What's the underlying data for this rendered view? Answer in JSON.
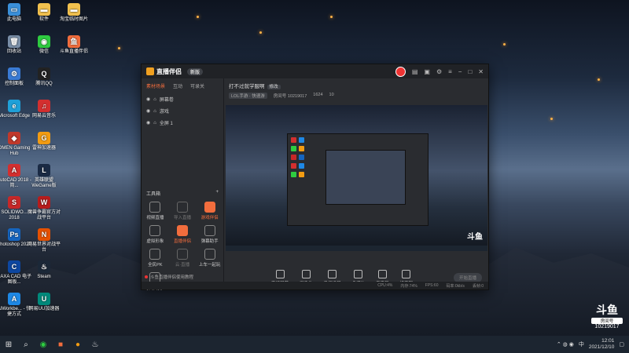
{
  "desktop_icons": [
    {
      "label": "此电脑",
      "col": 0,
      "row": 0,
      "color": "#3a8fd9",
      "glyph": "▭"
    },
    {
      "label": "回收站",
      "col": 0,
      "row": 1,
      "color": "#7a8fa8",
      "glyph": "🗑"
    },
    {
      "label": "控制面板",
      "col": 0,
      "row": 2,
      "color": "#3a7bd5",
      "glyph": "⚙"
    },
    {
      "label": "Microsoft Edge",
      "col": 0,
      "row": 3,
      "color": "#1fa0d8",
      "glyph": "e"
    },
    {
      "label": "OMEN Gaming Hub",
      "col": 0,
      "row": 4,
      "color": "#c0392b",
      "glyph": "◆"
    },
    {
      "label": "AutoCAD 2018 - 简...",
      "col": 0,
      "row": 5,
      "color": "#d32f2f",
      "glyph": "A"
    },
    {
      "label": "SOLIDWO... 2018",
      "col": 0,
      "row": 6,
      "color": "#c62828",
      "glyph": "S"
    },
    {
      "label": "Photoshop 2020",
      "col": 0,
      "row": 7,
      "color": "#1565c0",
      "glyph": "Ps"
    },
    {
      "label": "CAXA CAD 电子图板...",
      "col": 0,
      "row": 8,
      "color": "#0d47a1",
      "glyph": "C"
    },
    {
      "label": "AIWorkbe... - 快捷方式",
      "col": 0,
      "row": 9,
      "color": "#1e88e5",
      "glyph": "A"
    },
    {
      "label": "软件",
      "col": 1,
      "row": 0,
      "color": "#f2c14e",
      "glyph": "▬"
    },
    {
      "label": "微信",
      "col": 1,
      "row": 1,
      "color": "#2ecc40",
      "glyph": "◉"
    },
    {
      "label": "腾讯QQ",
      "col": 1,
      "row": 2,
      "color": "#222",
      "glyph": "Q"
    },
    {
      "label": "网易云音乐",
      "col": 1,
      "row": 3,
      "color": "#d32f2f",
      "glyph": "♫"
    },
    {
      "label": "雷神加速器",
      "col": 1,
      "row": 4,
      "color": "#f39c12",
      "glyph": "G"
    },
    {
      "label": "英雄联盟 WeGame版",
      "col": 1,
      "row": 5,
      "color": "#1a2a44",
      "glyph": "L"
    },
    {
      "label": "魔兽争霸官方对战平台",
      "col": 1,
      "row": 6,
      "color": "#b71c1c",
      "glyph": "W"
    },
    {
      "label": "网易世界对战平台",
      "col": 1,
      "row": 7,
      "color": "#e65100",
      "glyph": "N"
    },
    {
      "label": "Steam",
      "col": 1,
      "row": 8,
      "color": "#1b2838",
      "glyph": "♨"
    },
    {
      "label": "网易UU加速器",
      "col": 1,
      "row": 9,
      "color": "#00897b",
      "glyph": "U"
    },
    {
      "label": "淘宝临时图片",
      "col": 2,
      "row": 0,
      "color": "#f2c14e",
      "glyph": "▬"
    },
    {
      "label": "斗鱼直播伴侣",
      "col": 2,
      "row": 1,
      "color": "#f26d3d",
      "glyph": "鱼"
    }
  ],
  "app": {
    "name": "直播伴侣",
    "version_badge": "新版",
    "tabs": [
      "素材场景",
      "互动",
      "可录关"
    ],
    "scenes": [
      {
        "label": "屏幕卷"
      },
      {
        "label": "游戏"
      },
      {
        "label": "全屏 1"
      }
    ],
    "tools_title": "工具箱",
    "tools": [
      {
        "label": "视频直播",
        "state": "normal"
      },
      {
        "label": "导入直播",
        "state": "dim"
      },
      {
        "label": "游戏伴侣",
        "state": "red"
      },
      {
        "label": "虚拟形象",
        "state": "normal"
      },
      {
        "label": "直播伴侣",
        "state": "red"
      },
      {
        "label": "弹幕助手",
        "state": "normal"
      },
      {
        "label": "全民PK",
        "state": "normal"
      },
      {
        "label": "云·直播",
        "state": "dim"
      },
      {
        "label": "上车一起玩",
        "state": "normal"
      },
      {
        "label": "弹幕助手",
        "state": "normal"
      }
    ],
    "hint": "斗鱼直播伴侣使用教程",
    "stream_title": "打不过就学服啊",
    "edit_label": "修改",
    "category": "LOL手游 · 快速游",
    "room_label": "房间号 10219017",
    "stat1": "1624",
    "stat2": "10",
    "controls": [
      "直播屏幕",
      "摄像头",
      "手机投屏",
      "多媒体",
      "麦克风",
      "扬声器"
    ],
    "start_label": "开始直播",
    "status": [
      "CPU:4%",
      "内存:74%",
      "FPS:60",
      "码率:0kb/s",
      "丢帧:0"
    ]
  },
  "room_badge": {
    "big": "斗鱼",
    "label": "房间号",
    "number": "10219017"
  },
  "taskbar": {
    "time": "12:01",
    "date": "2021/12/10",
    "ime": "中"
  }
}
